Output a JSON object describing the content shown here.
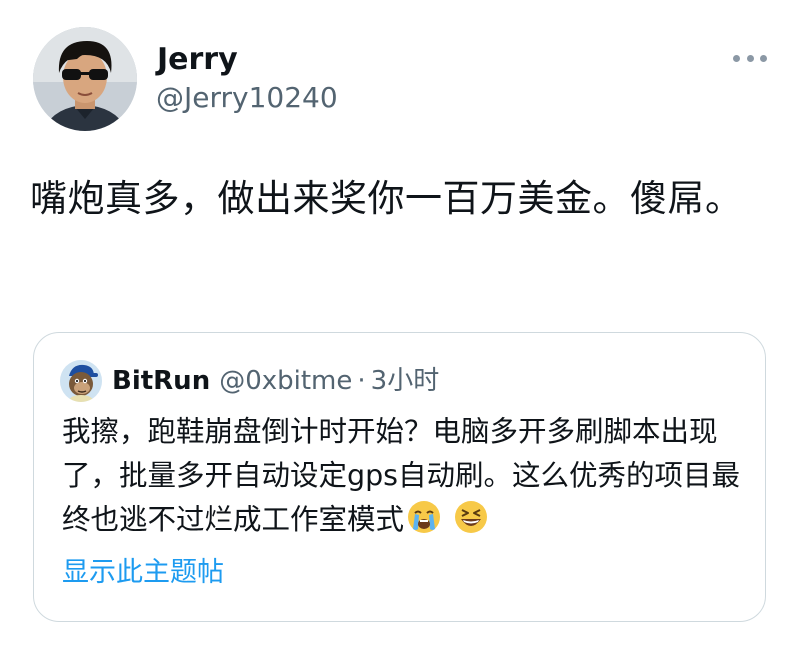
{
  "tweet": {
    "author": {
      "name": "Jerry",
      "handle": "@Jerry10240",
      "avatar_icon": "user-avatar-sunglasses"
    },
    "more_icon": "more-horizontal-icon",
    "text": "嘴炮真多，做出来奖你一百万美金。傻屌。"
  },
  "quote": {
    "author": {
      "name": "BitRun",
      "handle": "@0xbitme",
      "separator": "·",
      "time": "3小时",
      "avatar_icon": "ape-avatar"
    },
    "text": "我擦，跑鞋崩盘倒计时开始？电脑多开多刷脚本出现了，批量多开自动设定gps自动刷。这么优秀的项目最终也逃不过烂成工作室模式",
    "emojis": [
      "loudly-crying-face-emoji",
      "grinning-squinting-face-emoji"
    ],
    "show_thread": "显示此主题帖"
  },
  "colors": {
    "text": "#0f1419",
    "secondary": "#536471",
    "link": "#1d9bf0",
    "border": "#cfd9de"
  }
}
